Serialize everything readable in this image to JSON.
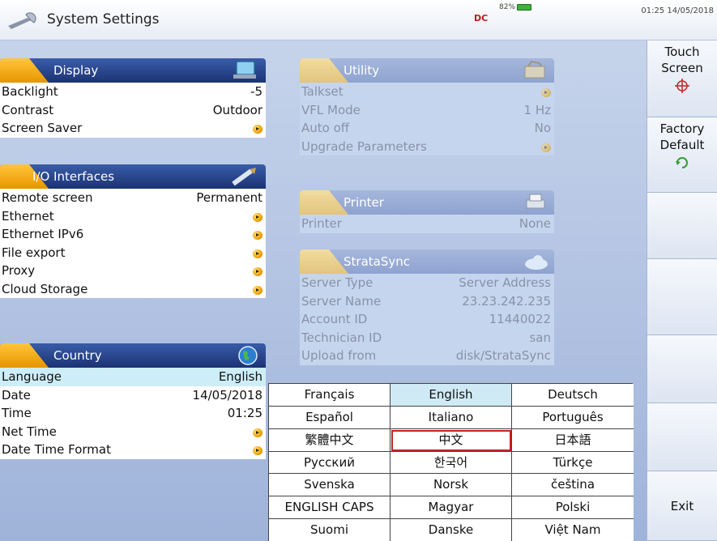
{
  "titlebar": {
    "title": "System Settings",
    "battery_text": "82%",
    "time": "01:25",
    "date": "14/05/2018",
    "dc_label": "DC"
  },
  "display": {
    "title": "Display",
    "rows": [
      {
        "label": "Backlight",
        "value": "-5"
      },
      {
        "label": "Contrast",
        "value": "Outdoor"
      },
      {
        "label": "Screen Saver",
        "value": ""
      }
    ]
  },
  "io": {
    "title": "I/O Interfaces",
    "rows": [
      {
        "label": "Remote screen",
        "value": "Permanent"
      },
      {
        "label": "Ethernet",
        "value": ""
      },
      {
        "label": "Ethernet IPv6",
        "value": ""
      },
      {
        "label": "File export",
        "value": ""
      },
      {
        "label": "Proxy",
        "value": ""
      },
      {
        "label": "Cloud Storage",
        "value": ""
      }
    ]
  },
  "country": {
    "title": "Country",
    "rows": [
      {
        "label": "Language",
        "value": "English"
      },
      {
        "label": "Date",
        "value": "14/05/2018"
      },
      {
        "label": "Time",
        "value": "01:25"
      },
      {
        "label": "Net Time",
        "value": ""
      },
      {
        "label": "Date Time Format",
        "value": ""
      }
    ]
  },
  "utility": {
    "title": "Utility",
    "rows": [
      {
        "label": "Talkset",
        "value": ""
      },
      {
        "label": "VFL Mode",
        "value": "1 Hz"
      },
      {
        "label": "Auto off",
        "value": "No"
      },
      {
        "label": "Upgrade Parameters",
        "value": ""
      }
    ]
  },
  "printer": {
    "title": "Printer",
    "rows": [
      {
        "label": "Printer",
        "value": "None"
      }
    ]
  },
  "stratasync": {
    "title": "StrataSync",
    "rows": [
      {
        "label": "Server Type",
        "value": "Server Address"
      },
      {
        "label": "Server Name",
        "value": "23.23.242.235"
      },
      {
        "label": "Account ID",
        "value": "11440022"
      },
      {
        "label": "Technician ID",
        "value": "san"
      },
      {
        "label": "Upload from",
        "value": "disk/StrataSync"
      }
    ]
  },
  "languages": [
    [
      "Français",
      "English",
      "Deutsch"
    ],
    [
      "Español",
      "Italiano",
      "Português"
    ],
    [
      "繁體中文",
      "中文",
      "日本語"
    ],
    [
      "Русский",
      "한국어",
      "Türkçe"
    ],
    [
      "Svenska",
      "Norsk",
      "čeština"
    ],
    [
      "ENGLISH CAPS",
      "Magyar",
      "Polski"
    ],
    [
      "Suomi",
      "Danske",
      "Việt Nam"
    ]
  ],
  "selected_language": "English",
  "focused_language": "中文",
  "function_keys": {
    "touch_screen": [
      "Touch",
      "Screen"
    ],
    "factory_default": [
      "Factory",
      "Default"
    ],
    "exit": "Exit"
  },
  "colors": {
    "header_blue": "#1b3373",
    "accent_orange": "#f0a400",
    "focus_red": "#c42222",
    "selected_cell": "#cfeaf5"
  }
}
